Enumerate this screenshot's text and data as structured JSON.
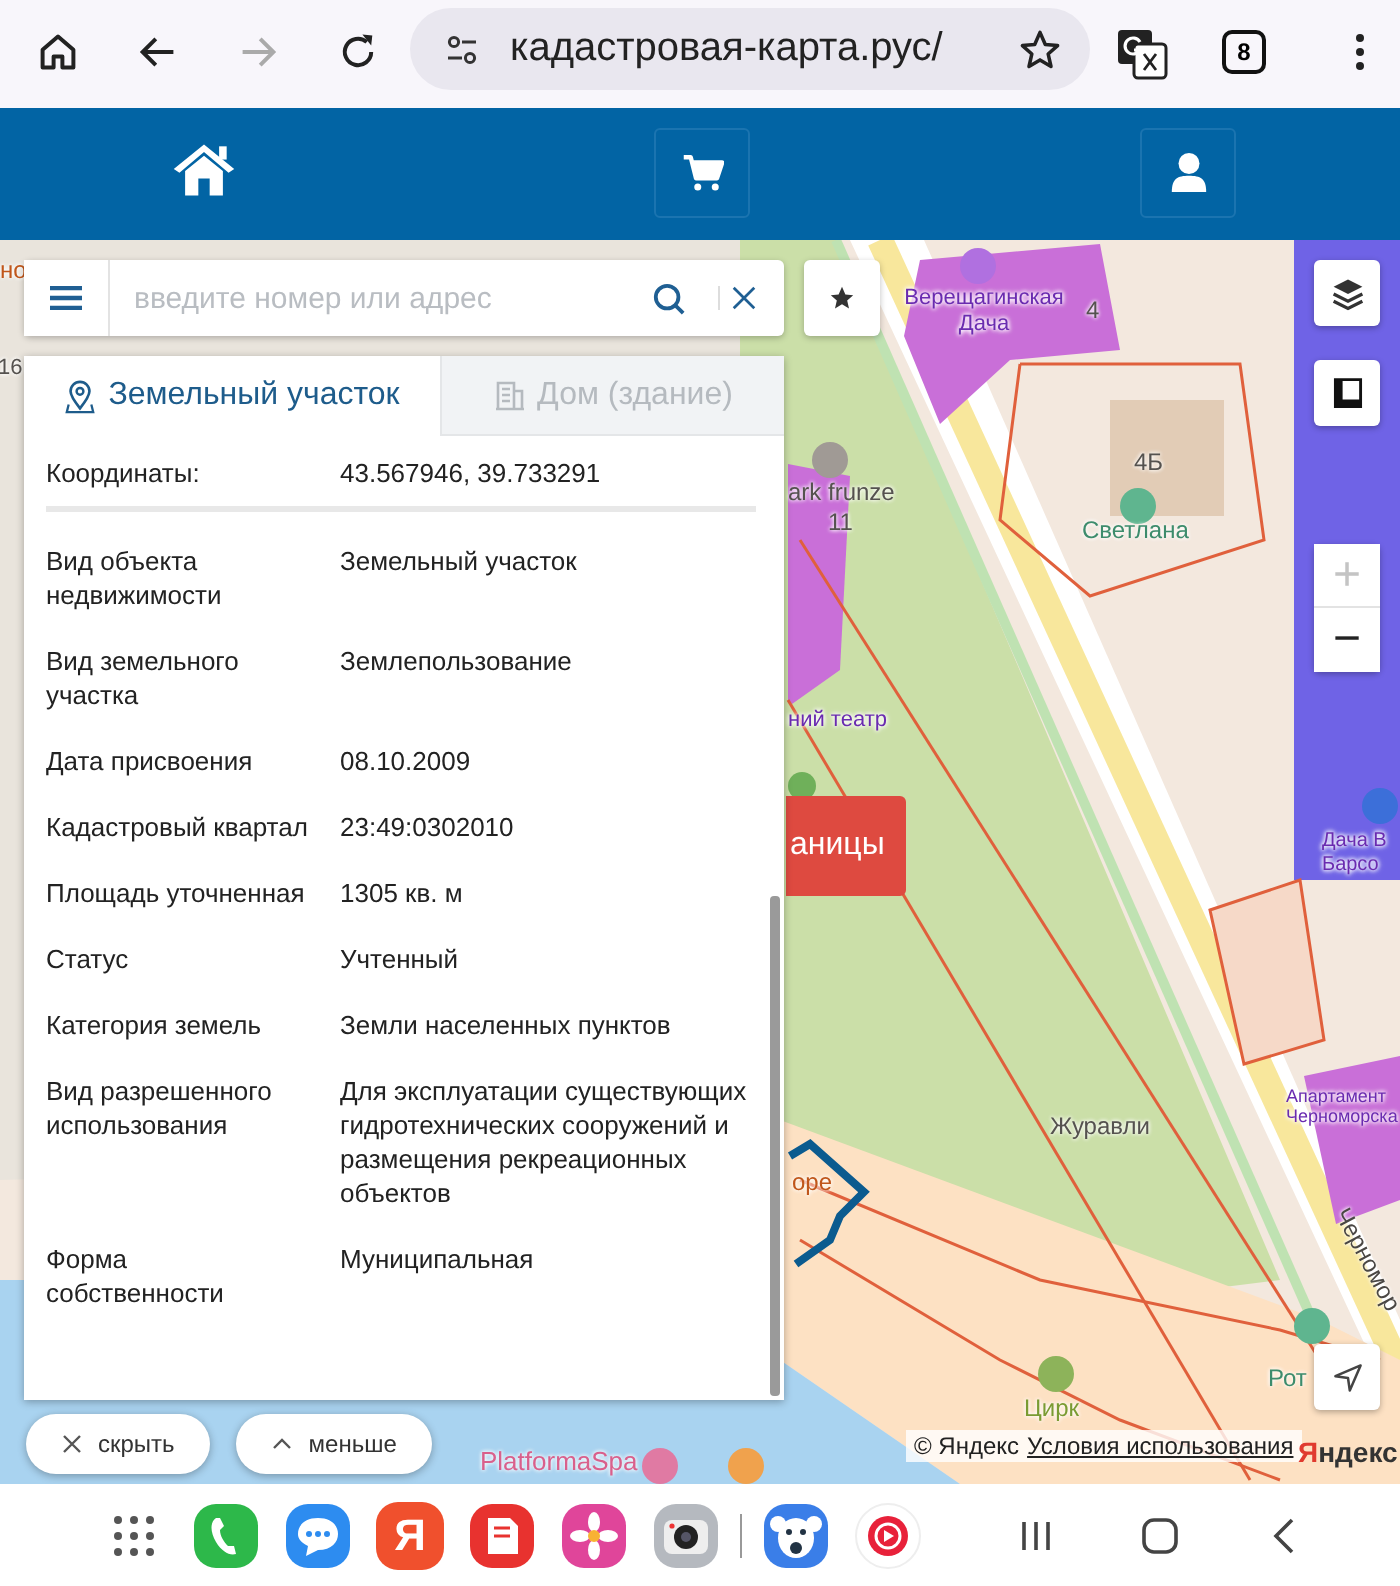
{
  "browser": {
    "url": "кадастровая-карта.рус/",
    "tab_count": "8",
    "forward_disabled": true
  },
  "header": {
    "buttons": [
      {
        "kind": "home"
      },
      {
        "kind": "cart"
      },
      {
        "kind": "user"
      }
    ]
  },
  "search": {
    "placeholder": "введите номер или адрес"
  },
  "tabs": [
    {
      "label": "Земельный участок",
      "kind": "land",
      "selected": true
    },
    {
      "label": "Дом (здание)",
      "kind": "building",
      "selected": false
    }
  ],
  "properties": [
    {
      "label": "Координаты:",
      "value": "43.567946, 39.733291"
    },
    {
      "label": "Вид объекта недвижимости",
      "value": "Земельный участок"
    },
    {
      "label": "Вид земельного участка",
      "value": "Землепользование"
    },
    {
      "label": "Дата присвоения",
      "value": "08.10.2009"
    },
    {
      "label": "Кадастровый квартал",
      "value": "23:49:0302010"
    },
    {
      "label": "Площадь уточненная",
      "value": "1305 кв. м"
    },
    {
      "label": "Статус",
      "value": "Учтенный"
    },
    {
      "label": "Категория земель",
      "value": "Земли населенных пунктов"
    },
    {
      "label": "Вид разрешенного использования",
      "value": "Для эксплуатации существующих гидротехнических сооружений и размещения рекреационных объектов"
    },
    {
      "label": "Форма собственности",
      "value": "Муниципальная"
    }
  ],
  "panel_buttons": [
    {
      "label": "скрыть",
      "kind": "close"
    },
    {
      "label": "меньше",
      "kind": "collapse"
    }
  ],
  "map": {
    "labels": [
      {
        "text": "но",
        "kind": "cafe"
      },
      {
        "text": "16",
        "kind": "house"
      },
      {
        "text": "Верещагинская Дача",
        "kind": "hotel"
      },
      {
        "text": "4",
        "kind": "house"
      },
      {
        "text": "4Б",
        "kind": "house"
      },
      {
        "text": "Светлана",
        "kind": "leisure"
      },
      {
        "text": "ark frunze",
        "kind": "house"
      },
      {
        "text": "11",
        "kind": "house"
      },
      {
        "text": "ний театр",
        "kind": "hotel"
      },
      {
        "text": "Дача В Барсо",
        "kind": "hotel"
      },
      {
        "text": "Журавли",
        "kind": "house"
      },
      {
        "text": "Апартамент Черноморска",
        "kind": "hotel"
      },
      {
        "text": "Черномор",
        "kind": "street"
      },
      {
        "text": "оре",
        "kind": "cafe"
      },
      {
        "text": "Рот",
        "kind": "leisure"
      },
      {
        "text": "Цирк",
        "kind": "park"
      },
      {
        "text": "PlatformaSpa",
        "kind": "spa"
      }
    ],
    "borders_button": "аницы",
    "zoom": [
      {
        "symbol": "+",
        "disabled": true
      },
      {
        "symbol": "−",
        "disabled": false
      }
    ],
    "attribution": {
      "copyright": "© Яндекс",
      "terms": "Условия использования",
      "logo": "Яндекс"
    }
  },
  "dock": [
    {
      "kind": "apps"
    },
    {
      "kind": "phone"
    },
    {
      "kind": "messages"
    },
    {
      "kind": "yandex",
      "letter": "Я"
    },
    {
      "kind": "notes"
    },
    {
      "kind": "gallery"
    },
    {
      "kind": "camera"
    },
    {
      "kind": "divider"
    },
    {
      "kind": "monkey"
    },
    {
      "kind": "music"
    }
  ],
  "nav": [
    {
      "kind": "recents"
    },
    {
      "kind": "home"
    },
    {
      "kind": "back"
    }
  ]
}
